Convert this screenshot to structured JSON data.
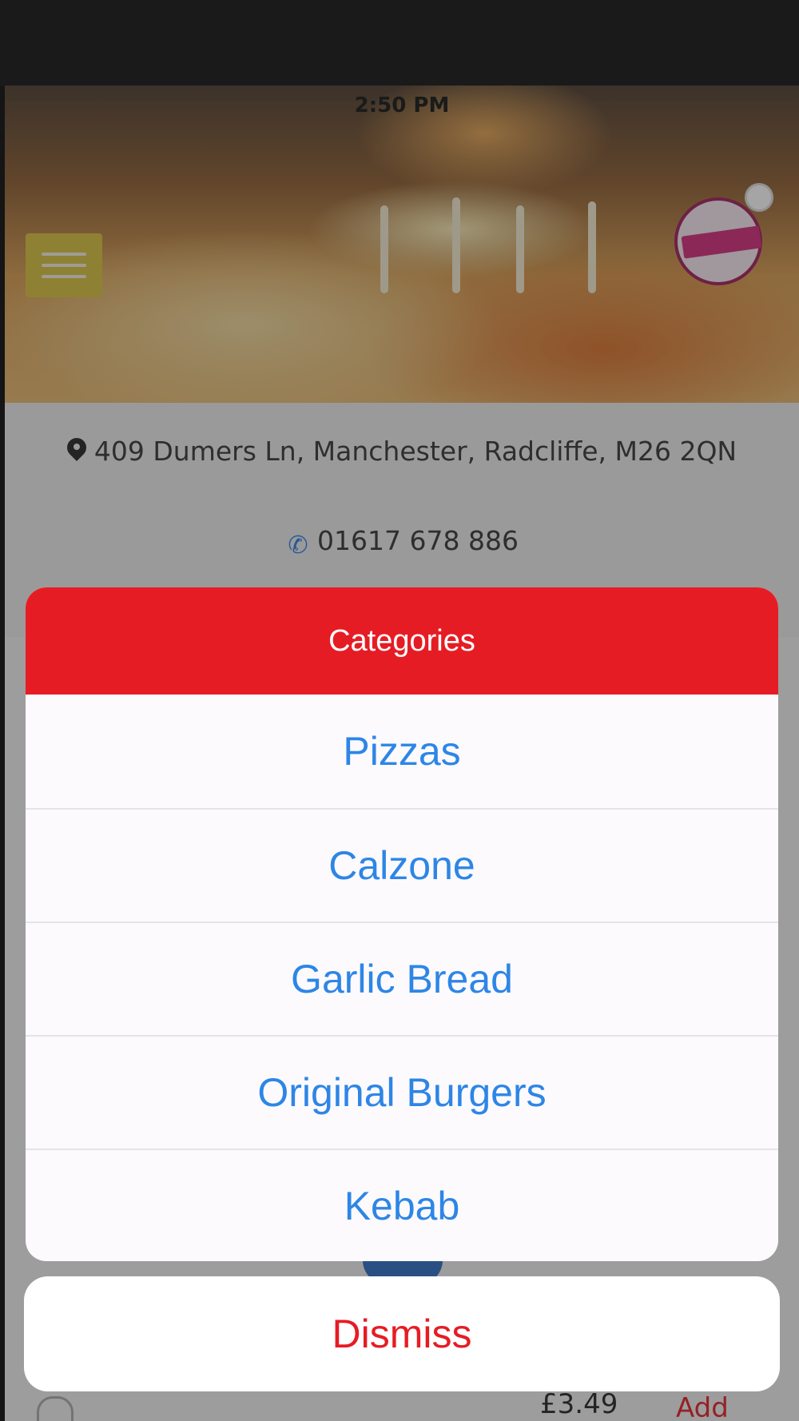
{
  "status_bar": {
    "time": "2:50 PM"
  },
  "restaurant": {
    "address": "409 Dumers Ln, Manchester, Radcliffe, M26 2QN",
    "phone": "01617 678 886",
    "icons": {
      "address": "map-pin-icon",
      "phone": "phone-icon",
      "menu": "hamburger-menu-icon",
      "logo": "restaurant-logo"
    }
  },
  "background_item": {
    "price": "£3.49",
    "add_label": "Add"
  },
  "action_sheet": {
    "title": "Categories",
    "items": [
      {
        "label": "Pizzas"
      },
      {
        "label": "Calzone"
      },
      {
        "label": "Garlic Bread"
      },
      {
        "label": "Original Burgers"
      },
      {
        "label": "Kebab"
      }
    ],
    "dismiss_label": "Dismiss"
  },
  "colors": {
    "header_red": "#e61c24",
    "item_blue": "#2d86e6",
    "menu_button": "#d8c23d",
    "phone_icon": "#2a7de1"
  }
}
